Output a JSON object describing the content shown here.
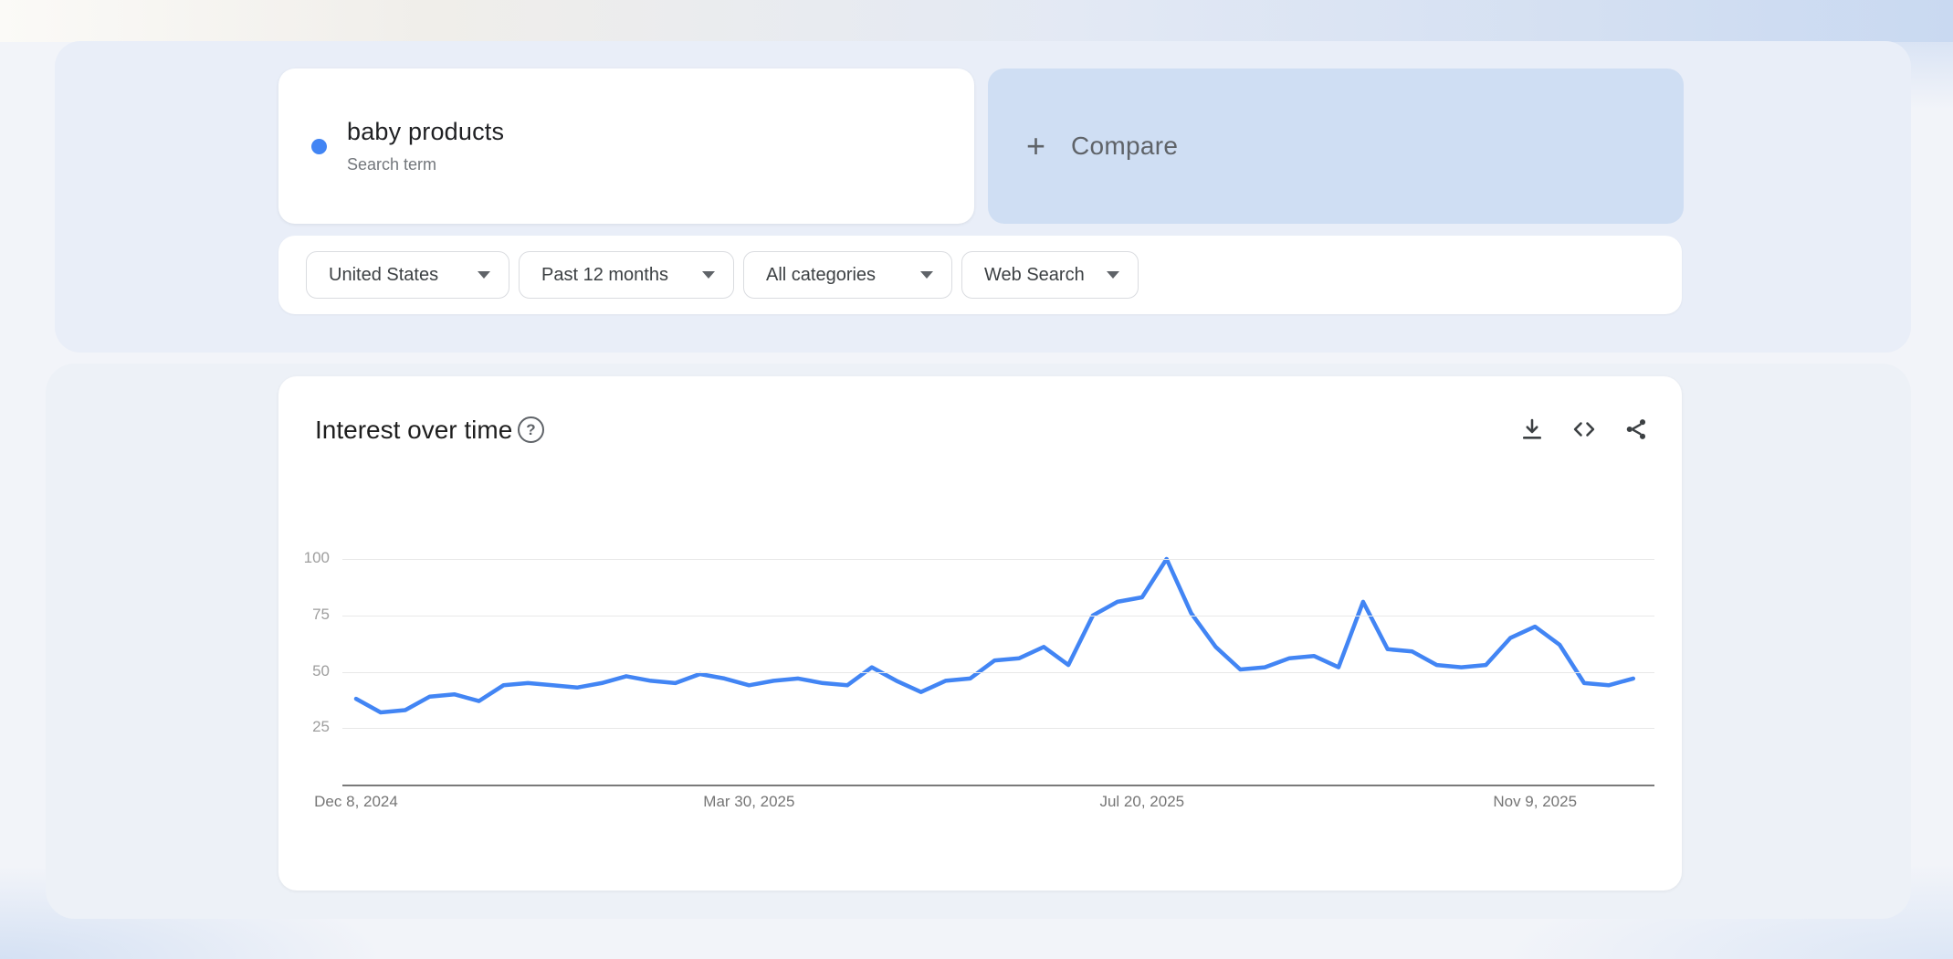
{
  "term_card": {
    "term": "baby products",
    "subtitle": "Search term",
    "dot_color": "#4285f4"
  },
  "compare_card": {
    "plus_glyph": "+",
    "label": "Compare"
  },
  "filters": [
    {
      "label": "United States"
    },
    {
      "label": "Past 12 months"
    },
    {
      "label": "All categories"
    },
    {
      "label": "Web Search"
    }
  ],
  "chart_card": {
    "title": "Interest over time",
    "help_glyph": "?"
  },
  "chart_data": {
    "type": "line",
    "title": "Interest over time",
    "x_unit": "weekly points, past 12 months",
    "x_ticks": [
      {
        "label": "Dec 8, 2024",
        "week_index": 0
      },
      {
        "label": "Mar 30, 2025",
        "week_index": 16
      },
      {
        "label": "Jul 20, 2025",
        "week_index": 32
      },
      {
        "label": "Nov 9, 2025",
        "week_index": 48
      }
    ],
    "y_ticks": [
      25,
      50,
      75,
      100
    ],
    "ylim": [
      0,
      100
    ],
    "grid": true,
    "legend": false,
    "series": [
      {
        "name": "baby products",
        "color": "#4285f4",
        "values": [
          38,
          32,
          33,
          39,
          40,
          37,
          44,
          45,
          44,
          43,
          45,
          48,
          46,
          45,
          49,
          47,
          44,
          46,
          47,
          45,
          44,
          52,
          46,
          41,
          46,
          47,
          55,
          56,
          61,
          53,
          75,
          81,
          83,
          100,
          76,
          61,
          51,
          52,
          56,
          57,
          52,
          81,
          60,
          59,
          53,
          52,
          53,
          65,
          70,
          62,
          45,
          44,
          47
        ]
      }
    ]
  }
}
